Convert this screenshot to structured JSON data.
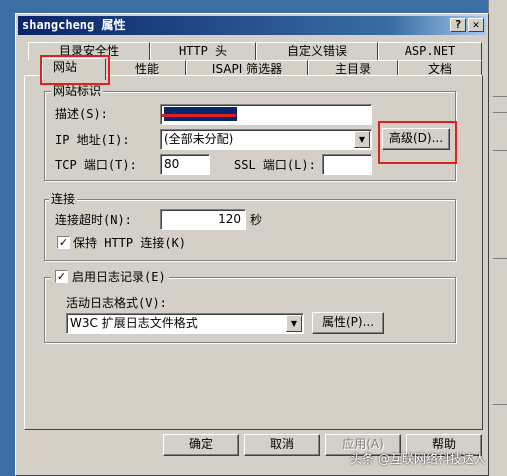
{
  "window": {
    "title": "shangcheng 属性",
    "help_button": "?",
    "close_button": "✕"
  },
  "tabs_back": [
    "目录安全性",
    "HTTP 头",
    "自定义错误",
    "ASP.NET"
  ],
  "tabs_front": [
    "网站",
    "性能",
    "ISAPI 筛选器",
    "主目录",
    "文档"
  ],
  "site_id_group": {
    "legend": "网站标识",
    "description_label": "描述(S):",
    "description_value": "shangcheng",
    "ip_label": "IP 地址(I):",
    "ip_value": "(全部未分配)",
    "advanced_button": "高级(D)...",
    "tcp_label": "TCP 端口(T):",
    "tcp_value": "80",
    "ssl_label": "SSL 端口(L):",
    "ssl_value": ""
  },
  "connection_group": {
    "legend": "连接",
    "timeout_label": "连接超时(N):",
    "timeout_value": "120",
    "timeout_unit": "秒",
    "keepalive_label": "保持 HTTP 连接(K)",
    "keepalive_checked": true
  },
  "logging_group": {
    "enable_label": "启用日志记录(E)",
    "enable_checked": true,
    "format_label": "活动日志格式(V):",
    "format_value": "W3C 扩展日志文件格式",
    "properties_button": "属性(P)..."
  },
  "buttons": {
    "ok": "确定",
    "cancel": "取消",
    "apply": "应用(A)",
    "help": "帮助"
  },
  "watermark": "头条 @互联网络科技达人",
  "colors": {
    "highlight_red": "#e02020",
    "titlebar": "#0a246a",
    "desktop": "#3a6ea5"
  }
}
